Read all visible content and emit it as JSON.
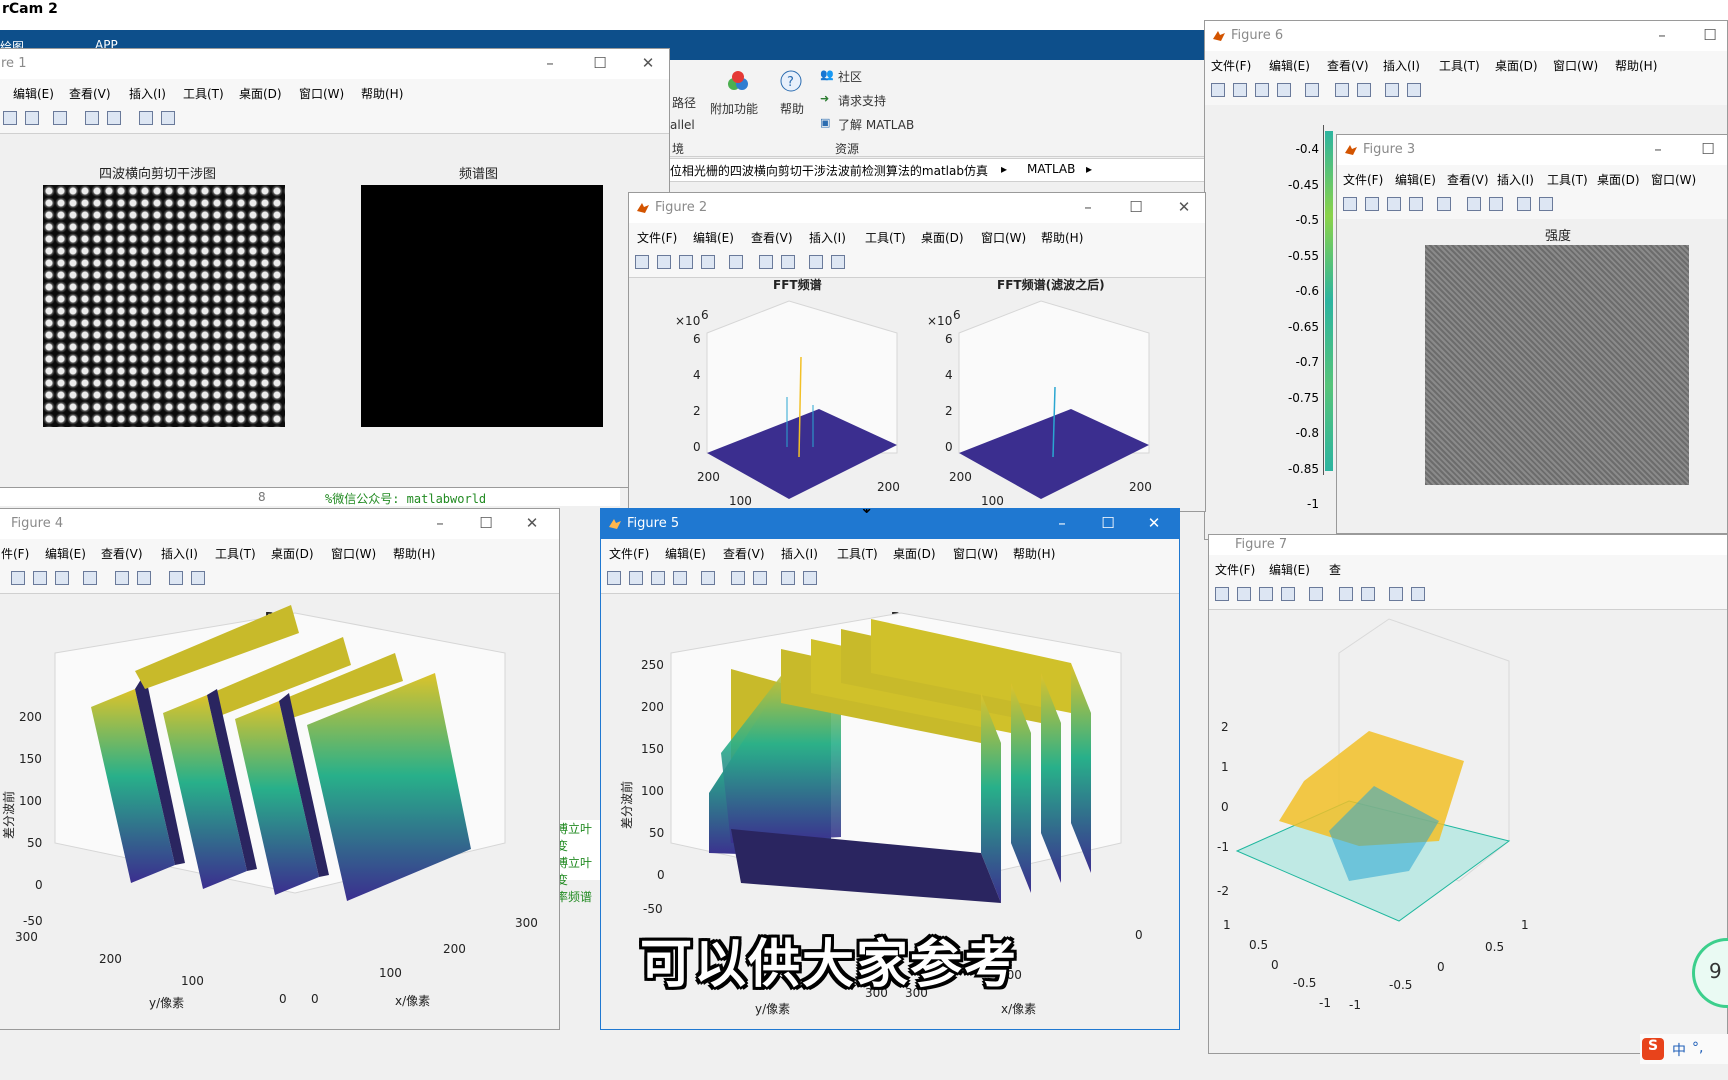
{
  "app_title": "rCam 2",
  "top_band": {
    "left_fragment": "绘图",
    "tab": "APP"
  },
  "ribbon": {
    "path_label": "路径",
    "parallel_label": "allel",
    "env_label": "境",
    "addons_label": "附加功能",
    "help_label": "帮助",
    "community": "社区",
    "support": "请求支持",
    "learn": "了解 MATLAB",
    "resources": "资源"
  },
  "address_bar": {
    "path": "F位相光栅的四波横向剪切干涉法波前检测算法的matlab仿真",
    "sep": "▸",
    "folder": "MATLAB",
    "sep2": "▸"
  },
  "editor": {
    "line_no": "8",
    "code": "%微信公众号: matlabworld",
    "side_lines": [
      "傅立叶变",
      "傅立叶变",
      "率频谱 "
    ]
  },
  "menu": [
    "文件(F)",
    "编辑(E)",
    "查看(V)",
    "插入(I)",
    "工具(T)",
    "桌面(D)",
    "窗口(W)",
    "帮助(H)"
  ],
  "menu_cut": [
    "件(F)",
    "编辑(E)",
    "查看(V)",
    "插入(I)",
    "工具(T)",
    "桌面(D)",
    "窗口(W)",
    "帮助(H)"
  ],
  "windows": {
    "fig1": {
      "title": "re 1",
      "captions": [
        "四波横向剪切干涉图",
        "频谱图"
      ]
    },
    "fig2": {
      "title": "Figure 2",
      "captions": [
        "FFT频谱",
        "FFT频谱(滤波之后)"
      ],
      "exponent": "×10",
      "exp_power": "6",
      "zticks": [
        "6",
        "4",
        "2",
        "0"
      ],
      "xticks": [
        "200",
        "100"
      ],
      "yticks": [
        "200"
      ]
    },
    "fig3": {
      "title": "Figure 3",
      "caption": "强度"
    },
    "fig4": {
      "title": "Figure 4",
      "caption": "Dx",
      "zlabel": "差分波前",
      "xlabel": "x/像素",
      "ylabel": "y/像素",
      "zticks": [
        "200",
        "150",
        "100",
        "50",
        "0",
        "-50"
      ],
      "yticks": [
        "300",
        "200",
        "100",
        "0"
      ],
      "xticks": [
        "0",
        "100",
        "200",
        "300"
      ]
    },
    "fig5": {
      "title": "Figure 5",
      "caption": "Dy",
      "zlabel": "差分波前",
      "xlabel": "x/像素",
      "ylabel": "y/像素",
      "zticks": [
        "250",
        "200",
        "150",
        "100",
        "50",
        "0",
        "-50"
      ],
      "xticks": [
        "100",
        "300",
        "300",
        "0"
      ]
    },
    "fig6": {
      "title": "Figure 6",
      "yticks": [
        "-0.4",
        "-0.45",
        "-0.5",
        "-0.55",
        "-0.6",
        "-0.65",
        "-0.7",
        "-0.75",
        "-0.8",
        "-0.85",
        "-1"
      ]
    },
    "fig7": {
      "title": "Figure 7",
      "menu": [
        "文件(F)",
        "编辑(E)",
        "查"
      ],
      "zticks": [
        "2",
        "1",
        "0",
        "-1",
        "-2"
      ],
      "yticks": [
        "1",
        "0.5",
        "0",
        "-0.5",
        "-1"
      ],
      "xticks": [
        "-1",
        "-0.5",
        "0",
        "0.5",
        "1"
      ]
    }
  },
  "subtitle": "可以供大家参考",
  "tray": {
    "ime": "中",
    "extra": "°,",
    "badge": "9"
  }
}
